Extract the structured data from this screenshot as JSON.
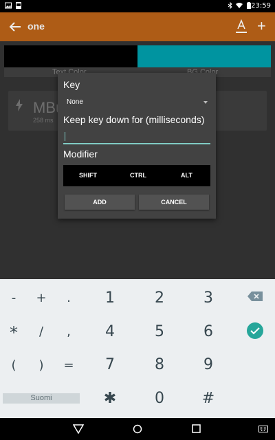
{
  "status_bar": {
    "time": "23:59"
  },
  "app_bar": {
    "title": "one"
  },
  "background": {
    "tab_text_label": "Text Color",
    "tab_bg_label": "BG Color",
    "card_title": "MBu",
    "card_sub": "258 ms"
  },
  "dialog": {
    "key_label": "Key",
    "key_value": "None",
    "keep_label": "Keep key down for (milliseconds)",
    "keep_value": "",
    "modifier_label": "Modifier",
    "modifiers": [
      "SHIFT",
      "CTRL",
      "ALT"
    ],
    "add": "ADD",
    "cancel": "CANCEL"
  },
  "keyboard": {
    "row1": [
      "-",
      "+",
      ".",
      "1",
      "2",
      "3"
    ],
    "row2": [
      "*",
      "/",
      ",",
      "4",
      "5",
      "6"
    ],
    "row3": [
      "(",
      ")",
      "=",
      "7",
      "8",
      "9"
    ],
    "row4": [
      "✱",
      "0",
      "#"
    ],
    "language": "Suomi"
  },
  "icons": {
    "back": "arrow-left-icon",
    "text_format": "text-format-icon",
    "add": "plus-icon",
    "backspace": "backspace-icon",
    "done": "check-circle-icon",
    "nav_back": "triangle-back-icon",
    "nav_home": "circle-home-icon",
    "nav_recents": "square-recents-icon",
    "nav_keyboard": "keyboard-icon"
  },
  "colors": {
    "app_bar": "#ae5c16",
    "accent": "#26a69a",
    "dialog_bg": "#424242",
    "bg_color_swatch": "#0094a0"
  }
}
